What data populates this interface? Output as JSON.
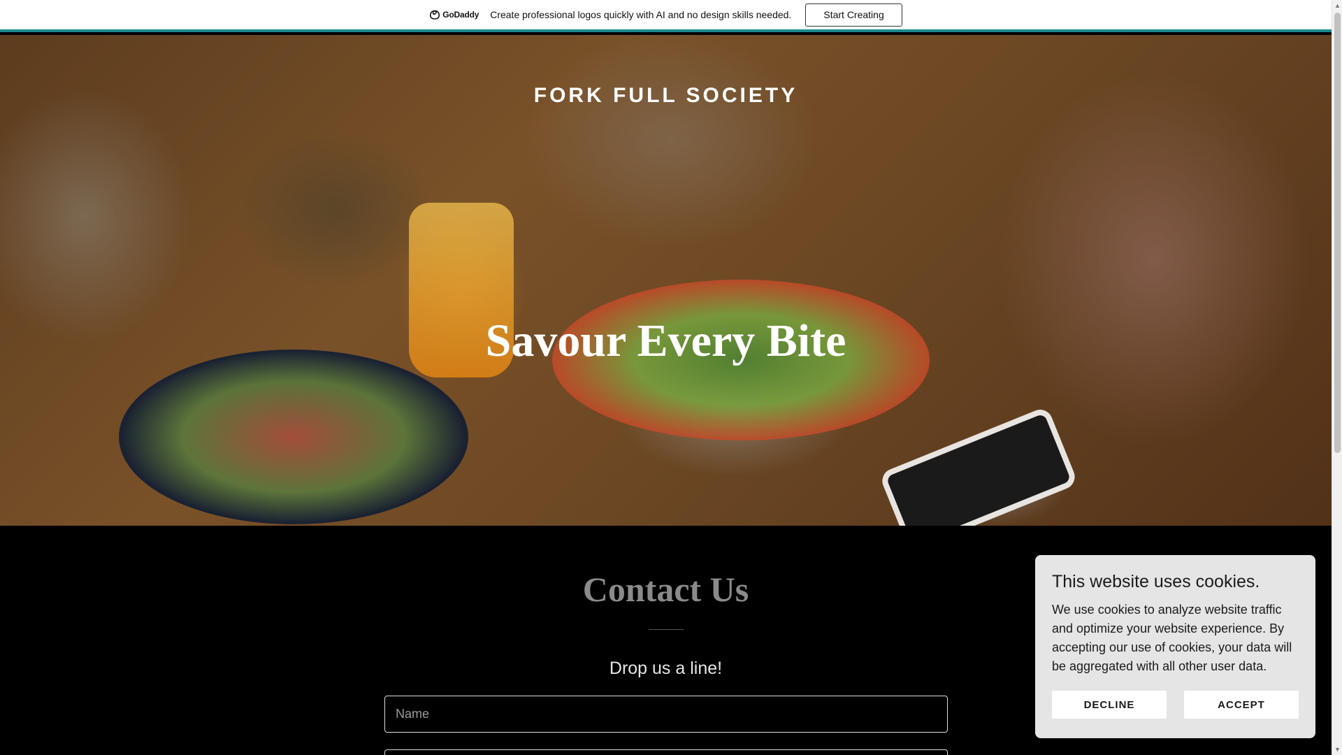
{
  "promo_bar": {
    "logo_text": "GoDaddy",
    "message": "Create professional logos quickly with AI and no design skills needed.",
    "button_label": "Start Creating",
    "accent_color": "#1c8b8d"
  },
  "hero": {
    "site_title": "FORK FULL SOCIETY",
    "heading": "Savour Every Bite"
  },
  "contact": {
    "title": "Contact Us",
    "subtitle": "Drop us a line!",
    "name_placeholder": "Name",
    "email_placeholder": ""
  },
  "cookie_banner": {
    "title": "This website uses cookies.",
    "body": "We use cookies to analyze website traffic and optimize your website experience. By accepting our use of cookies, your data will be aggregated with all other user data.",
    "decline_label": "DECLINE",
    "accept_label": "ACCEPT"
  },
  "icons": {
    "godaddy_logo": "godaddy-logo-icon",
    "scroll_up": "scroll-up-arrow-icon",
    "scroll_down": "scroll-down-arrow-icon"
  }
}
